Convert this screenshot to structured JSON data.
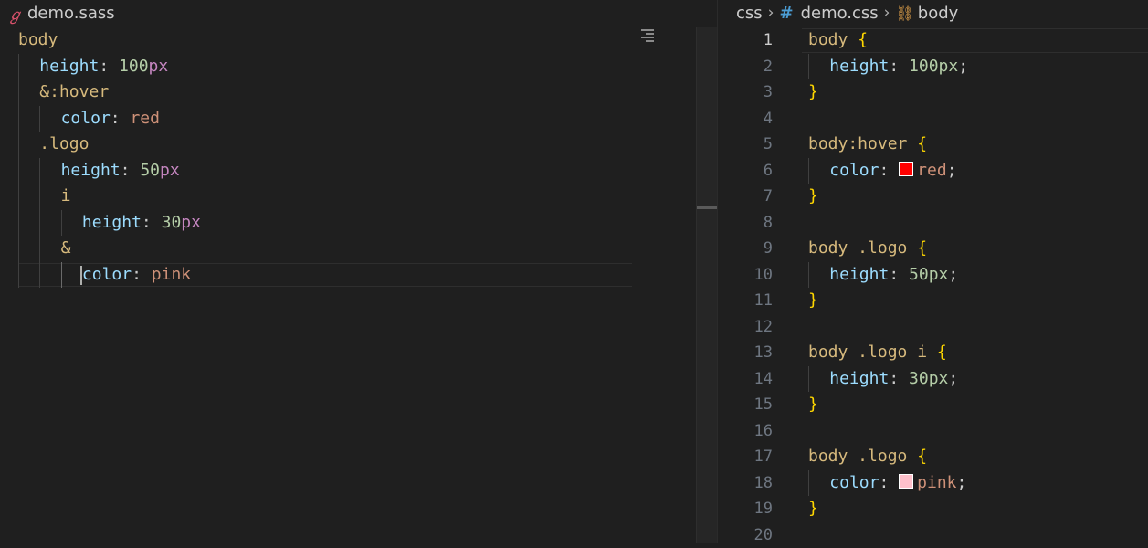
{
  "left_editor": {
    "tab": {
      "icon": "sass-icon",
      "filename": "demo.sass"
    },
    "lines": [
      {
        "indent": 0,
        "sel": "body"
      },
      {
        "indent": 1,
        "prop": "height",
        "colon": ":",
        "num": "100",
        "unit": "px"
      },
      {
        "indent": 1,
        "sel": "&:hover"
      },
      {
        "indent": 2,
        "prop": "color",
        "colon": ":",
        "val": "red"
      },
      {
        "indent": 1,
        "sel": ".logo"
      },
      {
        "indent": 2,
        "prop": "height",
        "colon": ":",
        "num": "50",
        "unit": "px"
      },
      {
        "indent": 2,
        "sel": "i"
      },
      {
        "indent": 3,
        "prop": "height",
        "colon": ":",
        "num": "30",
        "unit": "px"
      },
      {
        "indent": 2,
        "sel": "&"
      },
      {
        "indent": 3,
        "prop": "color",
        "colon": ":",
        "val": "pink"
      }
    ]
  },
  "right_editor": {
    "breadcrumb": {
      "folder": "css",
      "file_icon": "hash-icon",
      "file": "demo.css",
      "symbol_icon": "symbol-class-icon",
      "symbol": "body"
    },
    "active_line": 1,
    "line_numbers": [
      "1",
      "2",
      "3",
      "4",
      "5",
      "6",
      "7",
      "8",
      "9",
      "10",
      "11",
      "12",
      "13",
      "14",
      "15",
      "16",
      "17",
      "18",
      "19",
      "20"
    ],
    "lines": [
      {
        "type": "open",
        "sel": "body",
        "brace": "{"
      },
      {
        "type": "decl",
        "prop": "height",
        "colon": ":",
        "num": "100",
        "unit": "px",
        "semi": ";"
      },
      {
        "type": "close",
        "brace": "}"
      },
      {
        "type": "blank"
      },
      {
        "type": "open",
        "sel": "body:hover",
        "brace": "{"
      },
      {
        "type": "decl",
        "prop": "color",
        "colon": ":",
        "swatch": "#ff0000",
        "val": "red",
        "semi": ";"
      },
      {
        "type": "close",
        "brace": "}"
      },
      {
        "type": "blank"
      },
      {
        "type": "open",
        "sel": "body .logo",
        "brace": "{"
      },
      {
        "type": "decl",
        "prop": "height",
        "colon": ":",
        "num": "50",
        "unit": "px",
        "semi": ";"
      },
      {
        "type": "close",
        "brace": "}"
      },
      {
        "type": "blank"
      },
      {
        "type": "open",
        "sel": "body .logo i",
        "brace": "{"
      },
      {
        "type": "decl",
        "prop": "height",
        "colon": ":",
        "num": "30",
        "unit": "px",
        "semi": ";"
      },
      {
        "type": "close",
        "brace": "}"
      },
      {
        "type": "blank"
      },
      {
        "type": "open",
        "sel": "body .logo",
        "brace": "{"
      },
      {
        "type": "decl",
        "prop": "color",
        "colon": ":",
        "swatch": "#ffc0cb",
        "val": "pink",
        "semi": ";"
      },
      {
        "type": "close",
        "brace": "}"
      },
      {
        "type": "blank"
      }
    ]
  },
  "colors": {
    "background": "#1f1f1f",
    "selector": "#d7ba7d",
    "property": "#9cdcfe",
    "number": "#b5cea8",
    "unit": "#c586c0",
    "string_value": "#ce9178",
    "brace": "#ffd700"
  }
}
